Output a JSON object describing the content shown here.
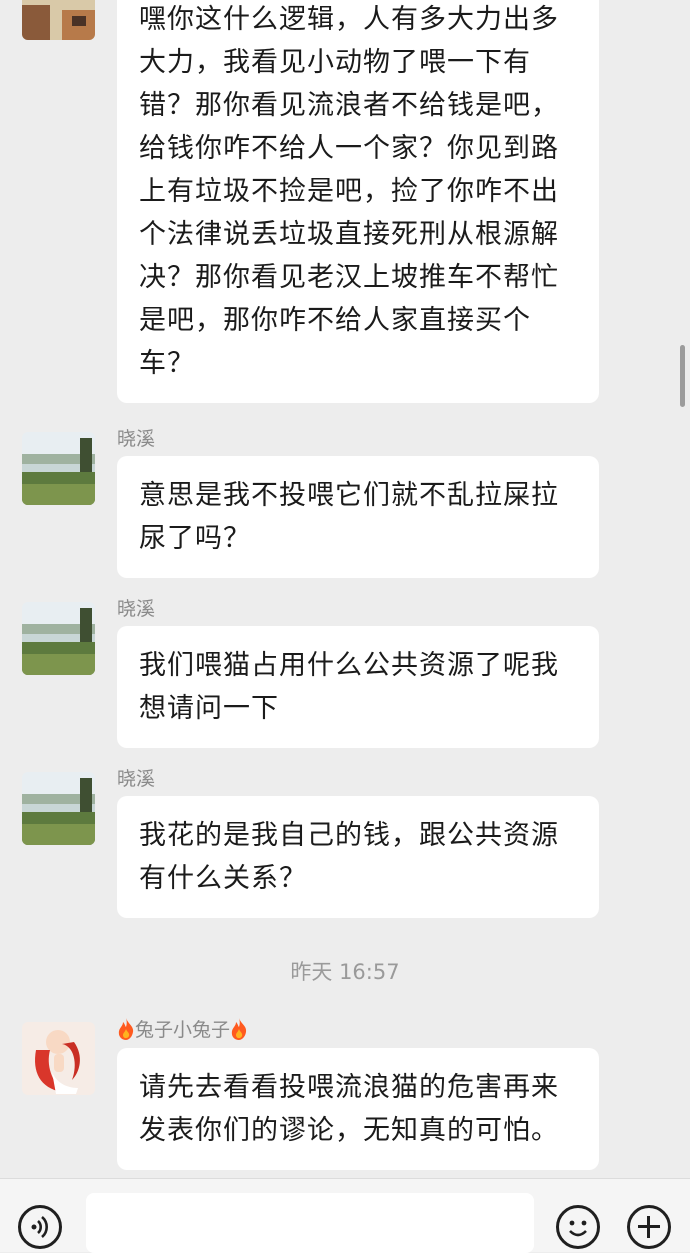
{
  "messages": [
    {
      "sender": "",
      "text": "嘿你这什么逻辑，人有多大力出多大力，我看见小动物了喂一下有错？那你看见流浪者不给钱是吧，给钱你咋不给人一个家？你见到路上有垃圾不捡是吧，捡了你咋不出个法律说丢垃圾直接死刑从根源解决？那你看见老汉上坡推车不帮忙是吧，那你咋不给人家直接买个车？"
    },
    {
      "sender": "晓溪",
      "text": "意思是我不投喂它们就不乱拉屎拉尿了吗？"
    },
    {
      "sender": "晓溪",
      "text": "我们喂猫占用什么公共资源了呢我想请问一下"
    },
    {
      "sender": "晓溪",
      "text": "我花的是我自己的钱，跟公共资源有什么关系？"
    },
    {
      "sender": "兔子小兔子",
      "text": "请先去看看投喂流浪猫的危害再来发表你们的谬论，无知真的可怕。"
    }
  ],
  "timestamp": "昨天 16:57",
  "input": {
    "value": "",
    "placeholder": ""
  },
  "icons": {
    "voice": "voice-icon",
    "emoji": "emoji-icon",
    "plus": "plus-icon",
    "fire": "fire-icon"
  },
  "colors": {
    "background": "#ededed",
    "bubble": "#ffffff",
    "sender_name": "#8a8a8a",
    "fire": "#ff5a1f"
  }
}
